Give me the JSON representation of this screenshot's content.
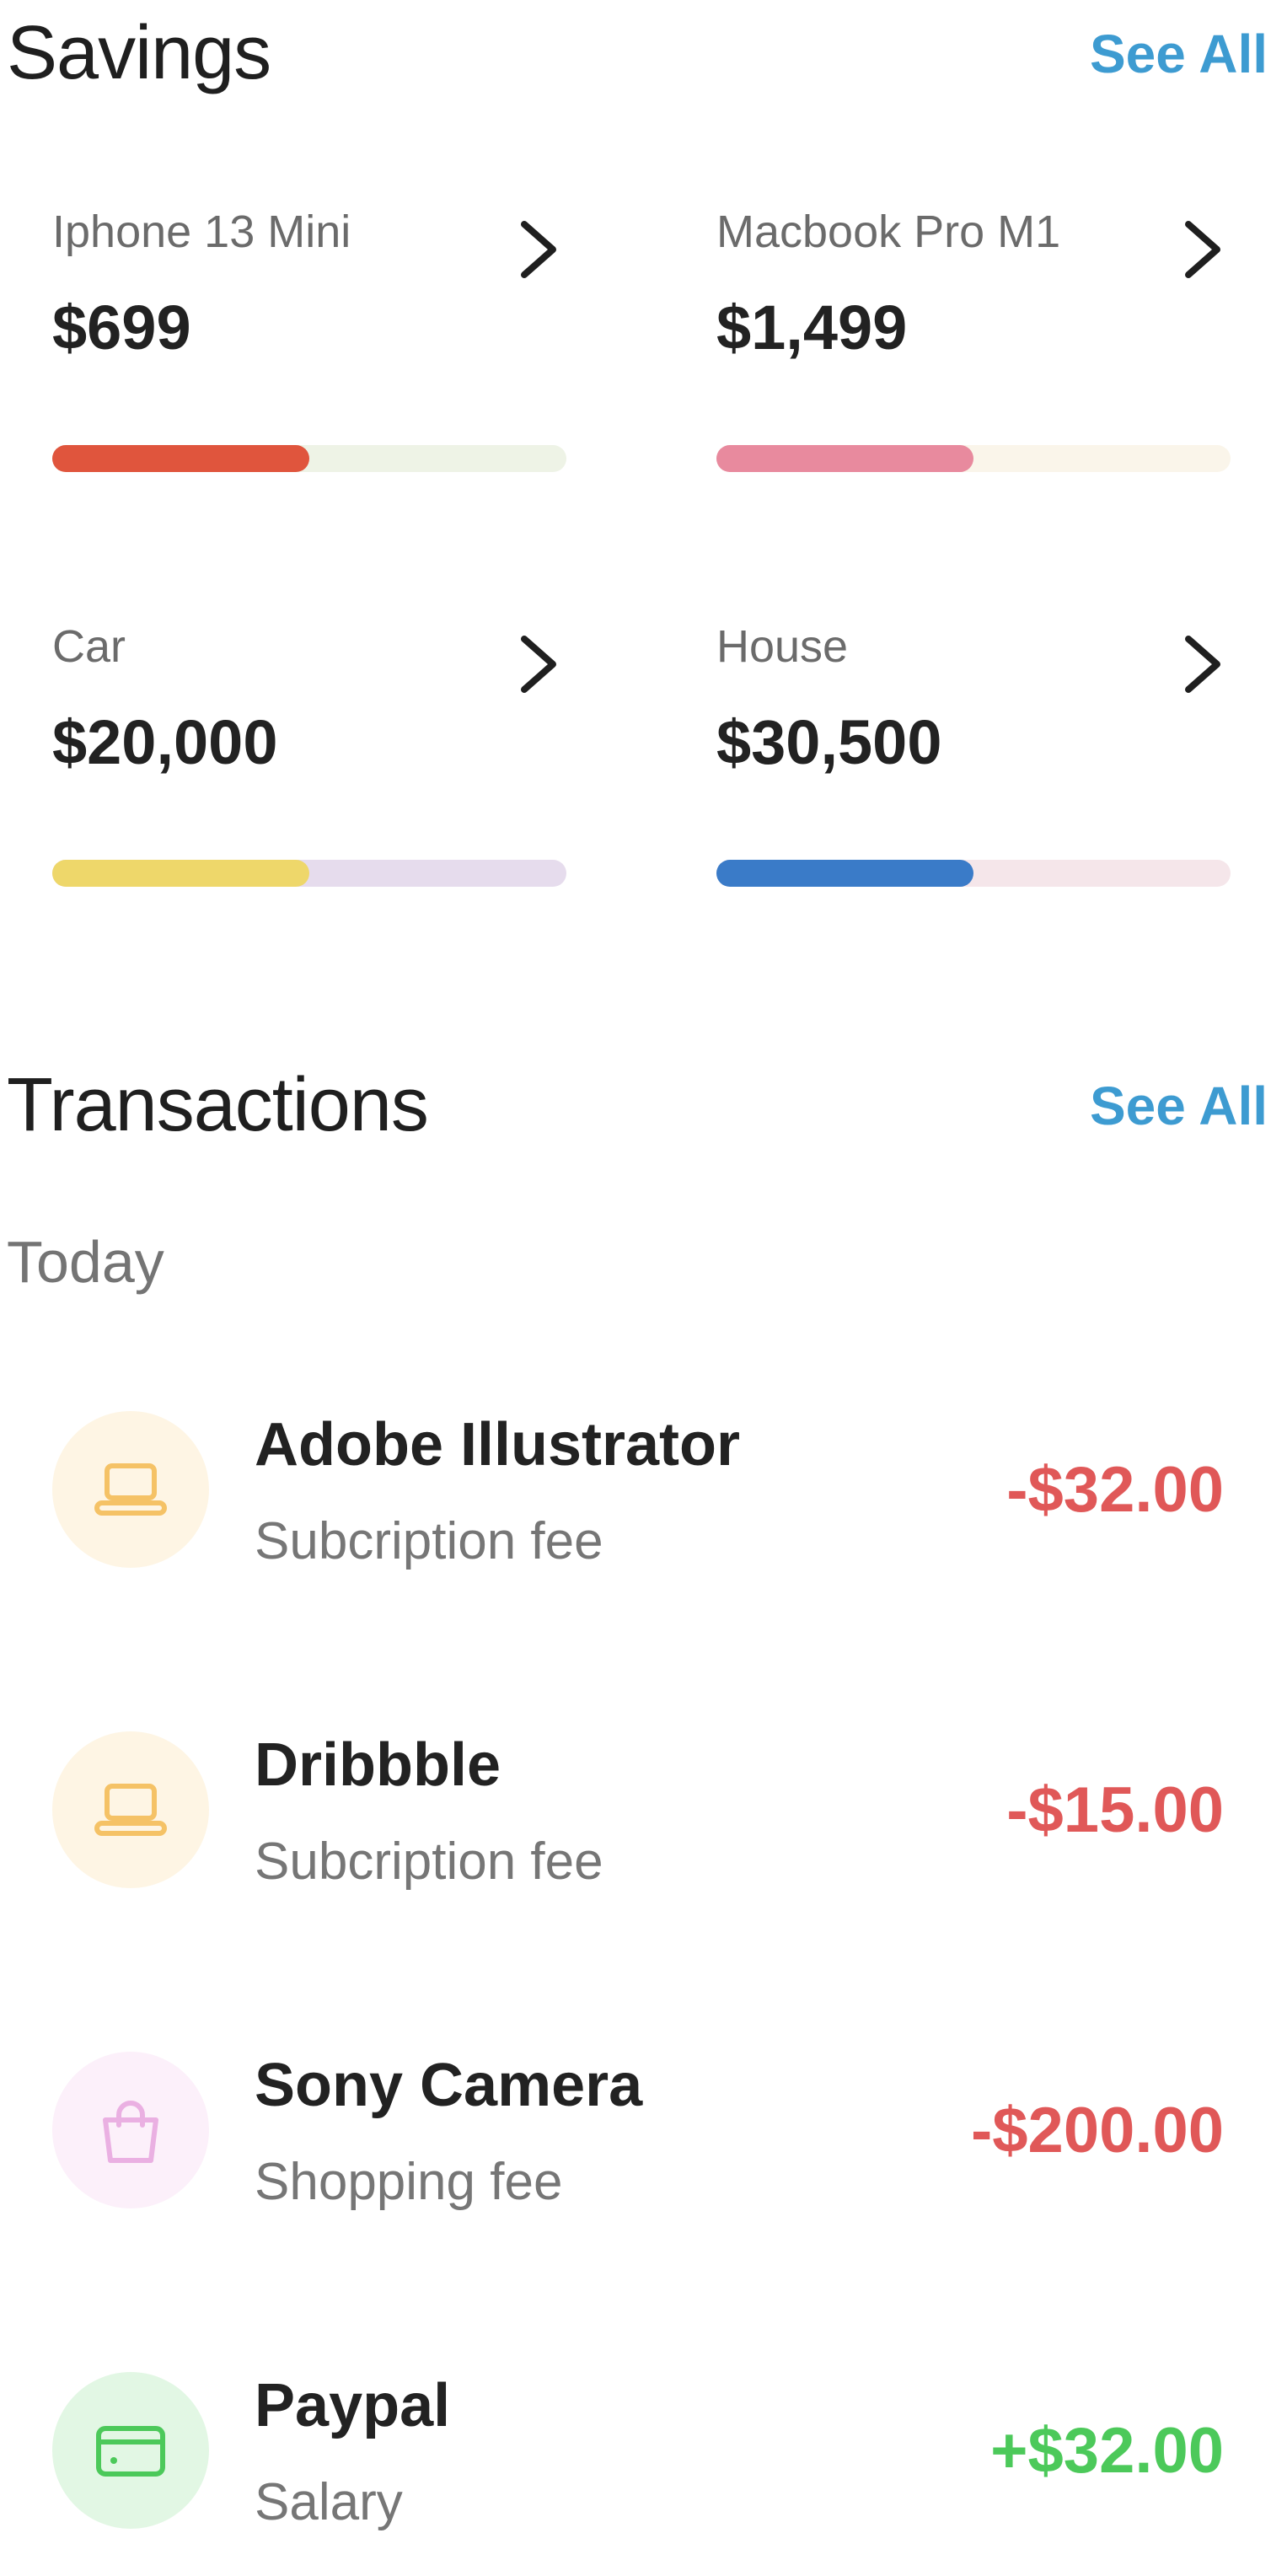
{
  "savings": {
    "title": "Savings",
    "see_all": "See All",
    "items": [
      {
        "name": "Iphone 13 Mini",
        "amount": "$699",
        "progress": 0.5,
        "bar_color": "#e0553d",
        "track_color": "#eef3e6",
        "icon": "chevron-right-icon"
      },
      {
        "name": "Macbook Pro M1",
        "amount": "$1,499",
        "progress": 0.5,
        "bar_color": "#e88a9e",
        "track_color": "#faf5ea",
        "icon": "chevron-right-icon"
      },
      {
        "name": "Car",
        "amount": "$20,000",
        "progress": 0.5,
        "bar_color": "#eed76a",
        "track_color": "#e6dced",
        "icon": "chevron-right-icon"
      },
      {
        "name": "House",
        "amount": "$30,500",
        "progress": 0.5,
        "bar_color": "#3a7bc8",
        "track_color": "#f5e6ea",
        "icon": "chevron-right-icon"
      }
    ]
  },
  "transactions": {
    "title": "Transactions",
    "see_all": "See All",
    "groups": [
      {
        "label": "Today",
        "items": [
          {
            "title": "Adobe Illustrator",
            "subtitle": "Subcription fee",
            "amount": "-$32.00",
            "type": "expense",
            "icon": "laptop-icon",
            "icon_color": "#f5c266",
            "icon_bg": "#fef5e4"
          },
          {
            "title": "Dribbble",
            "subtitle": "Subcription fee",
            "amount": "-$15.00",
            "type": "expense",
            "icon": "laptop-icon",
            "icon_color": "#f5c266",
            "icon_bg": "#fef5e4"
          },
          {
            "title": "Sony Camera",
            "subtitle": "Shopping fee",
            "amount": "-$200.00",
            "type": "expense",
            "icon": "shopping-bag-icon",
            "icon_color": "#eab0e2",
            "icon_bg": "#fcf0fa"
          },
          {
            "title": "Paypal",
            "subtitle": "Salary",
            "amount": "+$32.00",
            "type": "income",
            "icon": "credit-card-icon",
            "icon_color": "#4cc95a",
            "icon_bg": "#e2f7e4"
          }
        ]
      }
    ]
  },
  "colors": {
    "accent": "#3d9bd1",
    "expense": "#e05858",
    "income": "#4cc95a"
  }
}
